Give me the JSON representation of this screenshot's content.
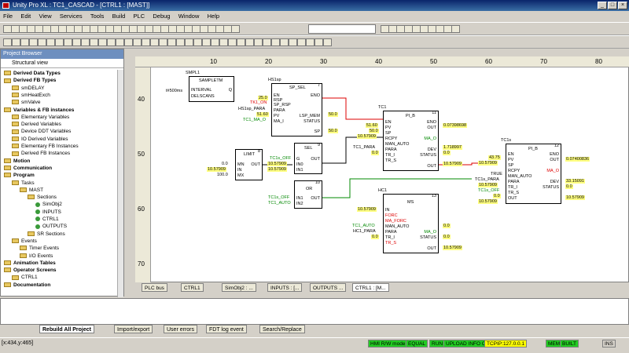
{
  "window": {
    "title": "Unity Pro XL : TC1_CASCAD - [CTRL1 : [MAST]]"
  },
  "menu": [
    "File",
    "Edit",
    "View",
    "Services",
    "Tools",
    "Build",
    "PLC",
    "Debug",
    "Window",
    "Help"
  ],
  "browser": {
    "title": "Project Browser",
    "view": "Structural view",
    "items": [
      {
        "label": "Derived Data Types",
        "bold": true,
        "indent": 0
      },
      {
        "label": "Derived FB Types",
        "bold": true,
        "indent": 0
      },
      {
        "label": "smDELAY",
        "bold": false,
        "indent": 1
      },
      {
        "label": "smHeatExch",
        "bold": false,
        "indent": 1
      },
      {
        "label": "smValve",
        "bold": false,
        "indent": 1
      },
      {
        "label": "Variables & FB instances",
        "bold": true,
        "indent": 0
      },
      {
        "label": "Elementary Variables",
        "bold": false,
        "indent": 1
      },
      {
        "label": "Derived Variables",
        "bold": false,
        "indent": 1
      },
      {
        "label": "Device DDT Variables",
        "bold": false,
        "indent": 1
      },
      {
        "label": "IO Derived Variables",
        "bold": false,
        "indent": 1
      },
      {
        "label": "Elementary FB Instances",
        "bold": false,
        "indent": 1
      },
      {
        "label": "Derived FB Instances",
        "bold": false,
        "indent": 1
      },
      {
        "label": "Motion",
        "bold": true,
        "indent": 0
      },
      {
        "label": "Communication",
        "bold": true,
        "indent": 0
      },
      {
        "label": "Program",
        "bold": true,
        "indent": 0
      },
      {
        "label": "Tasks",
        "bold": false,
        "indent": 1
      },
      {
        "label": "MAST",
        "bold": false,
        "indent": 2
      },
      {
        "label": "Sections",
        "bold": false,
        "indent": 3
      },
      {
        "label": "SimObj2",
        "bold": false,
        "indent": 4
      },
      {
        "label": "INPUTS",
        "bold": false,
        "indent": 4
      },
      {
        "label": "CTRL1",
        "bold": false,
        "indent": 4
      },
      {
        "label": "OUTPUTS",
        "bold": false,
        "indent": 4
      },
      {
        "label": "SR Sections",
        "bold": false,
        "indent": 3
      },
      {
        "label": "Events",
        "bold": false,
        "indent": 1
      },
      {
        "label": "Timer Events",
        "bold": false,
        "indent": 2
      },
      {
        "label": "I/O Events",
        "bold": false,
        "indent": 2
      },
      {
        "label": "Animation Tables",
        "bold": true,
        "indent": 0
      },
      {
        "label": "Operator Screens",
        "bold": true,
        "indent": 0
      },
      {
        "label": "CTRL1",
        "bold": false,
        "indent": 1
      },
      {
        "label": "Documentation",
        "bold": true,
        "indent": 0
      }
    ]
  },
  "ruler": {
    "cols": [
      "10",
      "20",
      "30",
      "40",
      "50",
      "60",
      "70",
      "80"
    ],
    "rows": [
      "40",
      "50",
      "60",
      "70"
    ]
  },
  "fbd": {
    "sampletm": {
      "instance": "SMPL1",
      "type": "SAMPLETM",
      "in1": "INTERVAL",
      "in2": "DELSCANS",
      "out": "Q",
      "v1": "t#500ms"
    },
    "sp_sel": {
      "instance": "HS1sp",
      "type": "SP_SEL",
      "num": "7",
      "pins": [
        "EN",
        "RSP",
        "SP_RSP",
        "PARA",
        "PV",
        "MA_I"
      ],
      "outs": [
        "ENO",
        "LSP_MEM",
        "STATUS",
        "SP"
      ],
      "vals": [
        "25.0",
        "TK1_ON",
        "HS1sp_PARA",
        "51.60",
        "TC1_MA_O"
      ],
      "outvals": [
        "50.0",
        "50.0"
      ]
    },
    "limit": {
      "type": "LIMIT",
      "num": "8",
      "pins": [
        "MN",
        "IN",
        "MX"
      ],
      "out": "OUT",
      "vals": [
        "0.0",
        "10.57909",
        "100.0"
      ]
    },
    "sel": {
      "type": "SEL",
      "num": "9",
      "pins": [
        "G",
        "IN0",
        "IN1"
      ],
      "out": "OUT",
      "vals": [
        "TC1s_OFF",
        "10.57909",
        "10.57909"
      ]
    },
    "or": {
      "type": "OR",
      "num": "10",
      "pins": [
        "IN1",
        "IN2"
      ],
      "out": "OUT",
      "vals": [
        "TC1s_OFF",
        "TC1_AUTO"
      ]
    },
    "pid1": {
      "instance": "TC1",
      "type": "PI_B",
      "num": "11",
      "pins": [
        "EN",
        "PV",
        "SP",
        "RCPY",
        "MAN_AUTO",
        "PARA",
        "TR_I",
        "TR_S"
      ],
      "outs": [
        "ENO",
        "OUT",
        "MA_O",
        "DEV",
        "STATUS",
        "OUT"
      ],
      "vals": [
        "51.60",
        "50.0",
        "10.57909",
        "TC1_PARA",
        "0.0"
      ],
      "outvals": [
        "0.07398698",
        "1.718997",
        "0.0",
        "10.57909"
      ]
    },
    "ms": {
      "instance": "HC1",
      "type": "MS",
      "num": "13",
      "pins": [
        "IN",
        "FORC",
        "MA_FORC",
        "MAN_AUTO",
        "PARA",
        "TR_I",
        "TR_S"
      ],
      "outs": [
        "MA_O",
        "STATUS",
        "OUT"
      ],
      "vals": [
        "10.57909",
        "TC1_AUTO",
        "HC1_PARA",
        "0.0"
      ],
      "outvals": [
        "0.0",
        "0.0",
        "10.57909"
      ]
    },
    "pid2": {
      "instance": "TC1s",
      "type": "PI_B",
      "num": "12",
      "pins": [
        "EN",
        "PV",
        "SP",
        "RCPY",
        "MAN_AUTO",
        "PARA",
        "TR_I",
        "TR_S",
        "OUT"
      ],
      "outs": [
        "ENO",
        "OUT",
        "MA_O",
        "DEV",
        "STATUS"
      ],
      "vals": [
        "43.75",
        "10.57909",
        "TRUE",
        "TC1s_PARA",
        "10.57909",
        "TC1s_OFF",
        "0.0",
        "10.57909"
      ],
      "outvals": [
        "0.07400836",
        "33.15091",
        "0.0",
        "10.57909"
      ]
    }
  },
  "tabs": [
    "PLC bus",
    "CTRL1",
    "SimObj2 : ...",
    "INPUTS : [...",
    "OUTPUTS ...",
    "CTRL1 : [M..."
  ],
  "output_tabs": [
    "Rebuild All Project",
    "Import/export",
    "User errors",
    "FDT log event",
    "Search/Replace"
  ],
  "status": {
    "coords": "[x:434,y:465]",
    "items": [
      "HMI R/W mode",
      "EQUAL",
      "RUN",
      "UPLOAD INFO OK",
      "TCPIP:127.0.0.1",
      "MEM",
      "BUILT",
      "INS"
    ]
  }
}
